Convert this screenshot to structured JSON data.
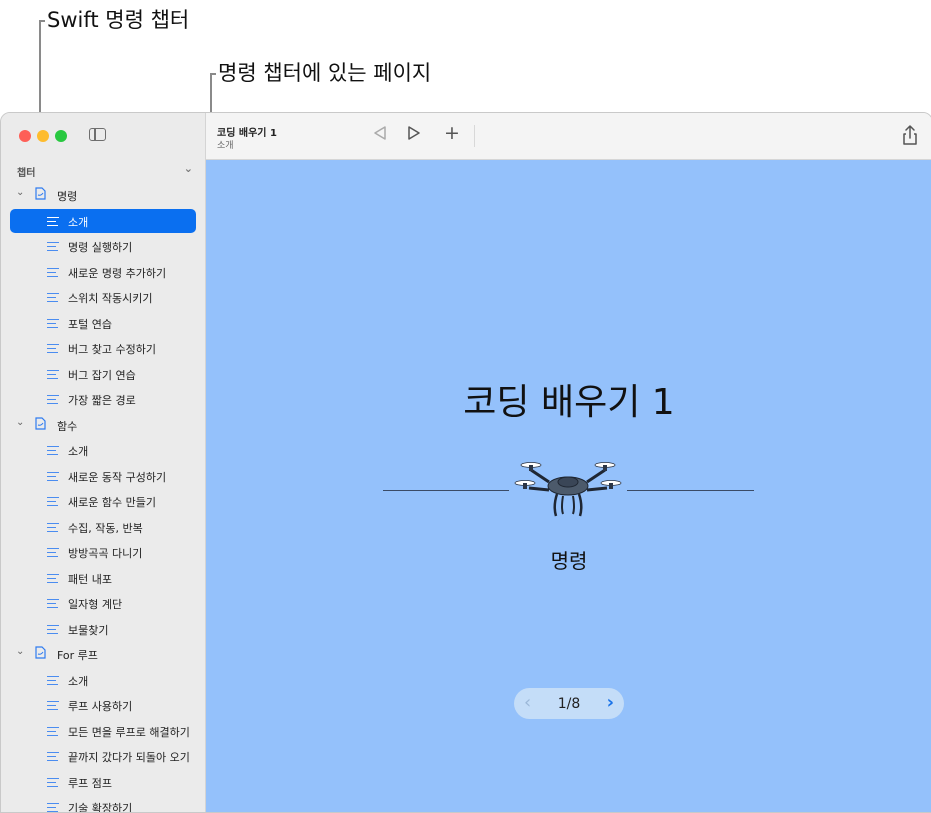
{
  "annotations": {
    "swift_chapter": "Swift 명령 챕터",
    "chapter_pages": "명령 챕터에 있는 페이지"
  },
  "sidebar": {
    "header": "챕터",
    "chapters": [
      {
        "label": "명령",
        "pages": [
          "소개",
          "명령 실행하기",
          "새로운 명령 추가하기",
          "스위치 작동시키기",
          "포털 연습",
          "버그 찾고 수정하기",
          "버그 잡기 연습",
          "가장 짧은 경로"
        ]
      },
      {
        "label": "함수",
        "pages": [
          "소개",
          "새로운 동작 구성하기",
          "새로운 함수 만들기",
          "수집, 작동, 반복",
          "방방곡곡 다니기",
          "패턴 내포",
          "일자형 계단",
          "보물찾기"
        ]
      },
      {
        "label": "For 루프",
        "pages": [
          "소개",
          "루프 사용하기",
          "모든 면을 루프로 해결하기",
          "끝까지 갔다가 되돌아 오기",
          "루프 점프",
          "기술 확장하기"
        ]
      }
    ],
    "selected": "명령 / 소개"
  },
  "toolbar": {
    "title": "코딩 배우기 1",
    "subtitle": "소개",
    "prev_icon": "‹",
    "next_icon": "›",
    "add_icon": "+"
  },
  "content": {
    "cover_title": "코딩 배우기 1",
    "chapter_name": "명령",
    "pager": "1/8",
    "background": "#94c1fb"
  }
}
